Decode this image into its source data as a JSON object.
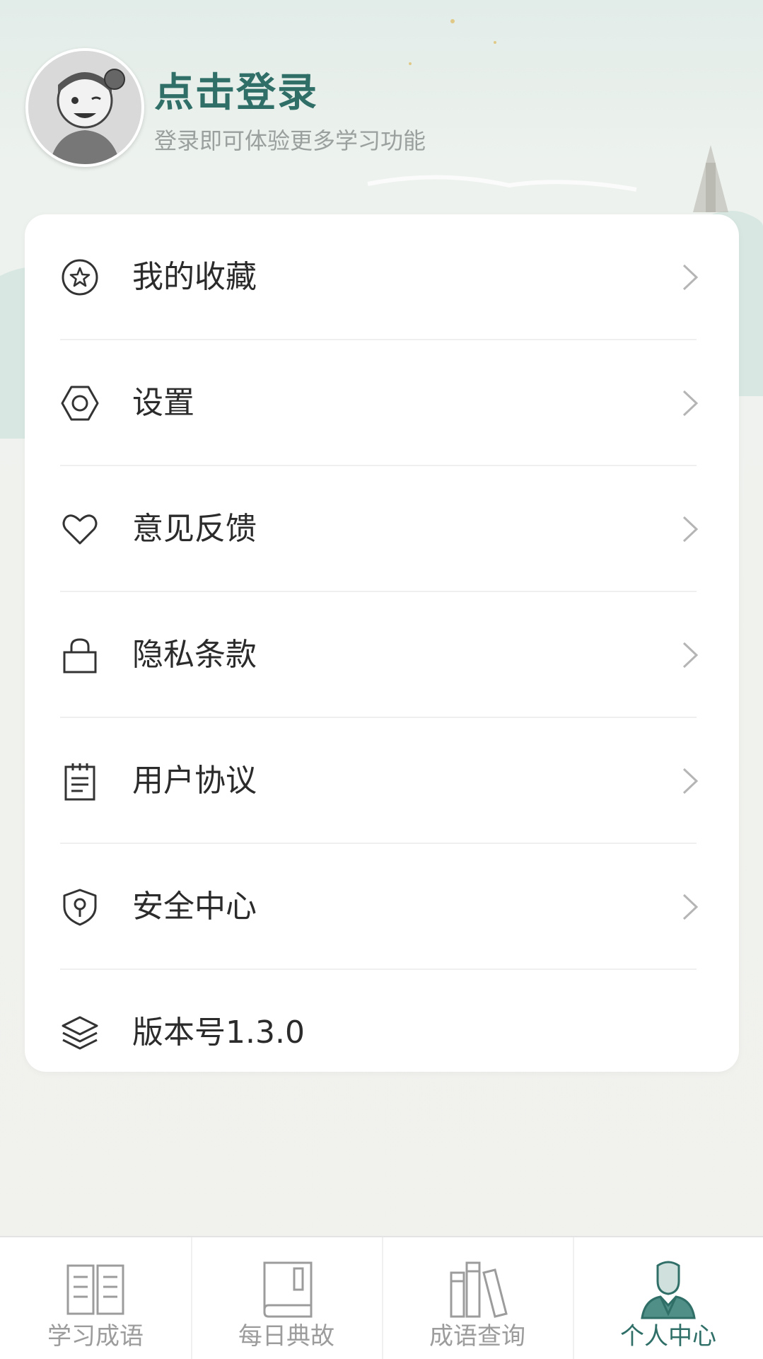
{
  "header": {
    "login_title": "点击登录",
    "login_subtitle": "登录即可体验更多学习功能"
  },
  "menu": {
    "items": [
      {
        "label": "我的收藏",
        "icon": "star-circle-icon"
      },
      {
        "label": "设置",
        "icon": "hexagon-settings-icon"
      },
      {
        "label": "意见反馈",
        "icon": "heart-icon"
      },
      {
        "label": "隐私条款",
        "icon": "lock-icon"
      },
      {
        "label": "用户协议",
        "icon": "notepad-icon"
      },
      {
        "label": "安全中心",
        "icon": "shield-keyhole-icon"
      },
      {
        "label": "版本号1.3.0",
        "icon": "layers-icon"
      }
    ]
  },
  "tabbar": {
    "tabs": [
      {
        "label": "学习成语",
        "icon": "open-book-icon",
        "active": false
      },
      {
        "label": "每日典故",
        "icon": "closed-book-icon",
        "active": false
      },
      {
        "label": "成语查询",
        "icon": "books-shelf-icon",
        "active": false
      },
      {
        "label": "个人中心",
        "icon": "person-icon",
        "active": true
      }
    ]
  },
  "colors": {
    "accent": "#2f6f68",
    "inactive": "#9c9c9c",
    "text": "#2b2b2b"
  }
}
